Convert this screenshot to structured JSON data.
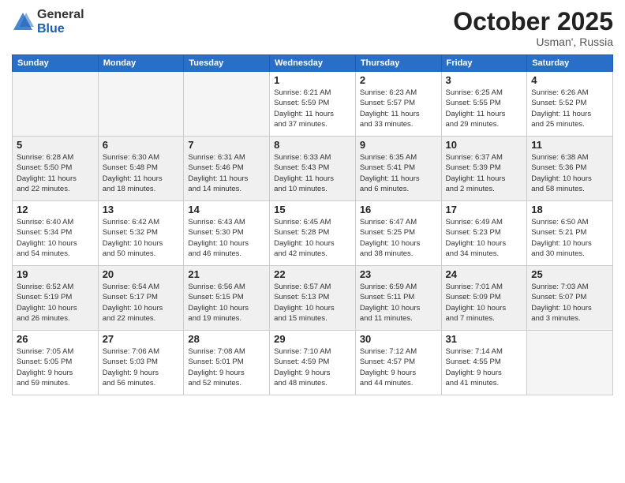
{
  "header": {
    "logo_general": "General",
    "logo_blue": "Blue",
    "month_title": "October 2025",
    "subtitle": "Usman', Russia"
  },
  "days_of_week": [
    "Sunday",
    "Monday",
    "Tuesday",
    "Wednesday",
    "Thursday",
    "Friday",
    "Saturday"
  ],
  "weeks": [
    {
      "shaded": false,
      "days": [
        {
          "num": "",
          "info": ""
        },
        {
          "num": "",
          "info": ""
        },
        {
          "num": "",
          "info": ""
        },
        {
          "num": "1",
          "info": "Sunrise: 6:21 AM\nSunset: 5:59 PM\nDaylight: 11 hours\nand 37 minutes."
        },
        {
          "num": "2",
          "info": "Sunrise: 6:23 AM\nSunset: 5:57 PM\nDaylight: 11 hours\nand 33 minutes."
        },
        {
          "num": "3",
          "info": "Sunrise: 6:25 AM\nSunset: 5:55 PM\nDaylight: 11 hours\nand 29 minutes."
        },
        {
          "num": "4",
          "info": "Sunrise: 6:26 AM\nSunset: 5:52 PM\nDaylight: 11 hours\nand 25 minutes."
        }
      ]
    },
    {
      "shaded": true,
      "days": [
        {
          "num": "5",
          "info": "Sunrise: 6:28 AM\nSunset: 5:50 PM\nDaylight: 11 hours\nand 22 minutes."
        },
        {
          "num": "6",
          "info": "Sunrise: 6:30 AM\nSunset: 5:48 PM\nDaylight: 11 hours\nand 18 minutes."
        },
        {
          "num": "7",
          "info": "Sunrise: 6:31 AM\nSunset: 5:46 PM\nDaylight: 11 hours\nand 14 minutes."
        },
        {
          "num": "8",
          "info": "Sunrise: 6:33 AM\nSunset: 5:43 PM\nDaylight: 11 hours\nand 10 minutes."
        },
        {
          "num": "9",
          "info": "Sunrise: 6:35 AM\nSunset: 5:41 PM\nDaylight: 11 hours\nand 6 minutes."
        },
        {
          "num": "10",
          "info": "Sunrise: 6:37 AM\nSunset: 5:39 PM\nDaylight: 11 hours\nand 2 minutes."
        },
        {
          "num": "11",
          "info": "Sunrise: 6:38 AM\nSunset: 5:36 PM\nDaylight: 10 hours\nand 58 minutes."
        }
      ]
    },
    {
      "shaded": false,
      "days": [
        {
          "num": "12",
          "info": "Sunrise: 6:40 AM\nSunset: 5:34 PM\nDaylight: 10 hours\nand 54 minutes."
        },
        {
          "num": "13",
          "info": "Sunrise: 6:42 AM\nSunset: 5:32 PM\nDaylight: 10 hours\nand 50 minutes."
        },
        {
          "num": "14",
          "info": "Sunrise: 6:43 AM\nSunset: 5:30 PM\nDaylight: 10 hours\nand 46 minutes."
        },
        {
          "num": "15",
          "info": "Sunrise: 6:45 AM\nSunset: 5:28 PM\nDaylight: 10 hours\nand 42 minutes."
        },
        {
          "num": "16",
          "info": "Sunrise: 6:47 AM\nSunset: 5:25 PM\nDaylight: 10 hours\nand 38 minutes."
        },
        {
          "num": "17",
          "info": "Sunrise: 6:49 AM\nSunset: 5:23 PM\nDaylight: 10 hours\nand 34 minutes."
        },
        {
          "num": "18",
          "info": "Sunrise: 6:50 AM\nSunset: 5:21 PM\nDaylight: 10 hours\nand 30 minutes."
        }
      ]
    },
    {
      "shaded": true,
      "days": [
        {
          "num": "19",
          "info": "Sunrise: 6:52 AM\nSunset: 5:19 PM\nDaylight: 10 hours\nand 26 minutes."
        },
        {
          "num": "20",
          "info": "Sunrise: 6:54 AM\nSunset: 5:17 PM\nDaylight: 10 hours\nand 22 minutes."
        },
        {
          "num": "21",
          "info": "Sunrise: 6:56 AM\nSunset: 5:15 PM\nDaylight: 10 hours\nand 19 minutes."
        },
        {
          "num": "22",
          "info": "Sunrise: 6:57 AM\nSunset: 5:13 PM\nDaylight: 10 hours\nand 15 minutes."
        },
        {
          "num": "23",
          "info": "Sunrise: 6:59 AM\nSunset: 5:11 PM\nDaylight: 10 hours\nand 11 minutes."
        },
        {
          "num": "24",
          "info": "Sunrise: 7:01 AM\nSunset: 5:09 PM\nDaylight: 10 hours\nand 7 minutes."
        },
        {
          "num": "25",
          "info": "Sunrise: 7:03 AM\nSunset: 5:07 PM\nDaylight: 10 hours\nand 3 minutes."
        }
      ]
    },
    {
      "shaded": false,
      "days": [
        {
          "num": "26",
          "info": "Sunrise: 7:05 AM\nSunset: 5:05 PM\nDaylight: 9 hours\nand 59 minutes."
        },
        {
          "num": "27",
          "info": "Sunrise: 7:06 AM\nSunset: 5:03 PM\nDaylight: 9 hours\nand 56 minutes."
        },
        {
          "num": "28",
          "info": "Sunrise: 7:08 AM\nSunset: 5:01 PM\nDaylight: 9 hours\nand 52 minutes."
        },
        {
          "num": "29",
          "info": "Sunrise: 7:10 AM\nSunset: 4:59 PM\nDaylight: 9 hours\nand 48 minutes."
        },
        {
          "num": "30",
          "info": "Sunrise: 7:12 AM\nSunset: 4:57 PM\nDaylight: 9 hours\nand 44 minutes."
        },
        {
          "num": "31",
          "info": "Sunrise: 7:14 AM\nSunset: 4:55 PM\nDaylight: 9 hours\nand 41 minutes."
        },
        {
          "num": "",
          "info": ""
        }
      ]
    }
  ]
}
